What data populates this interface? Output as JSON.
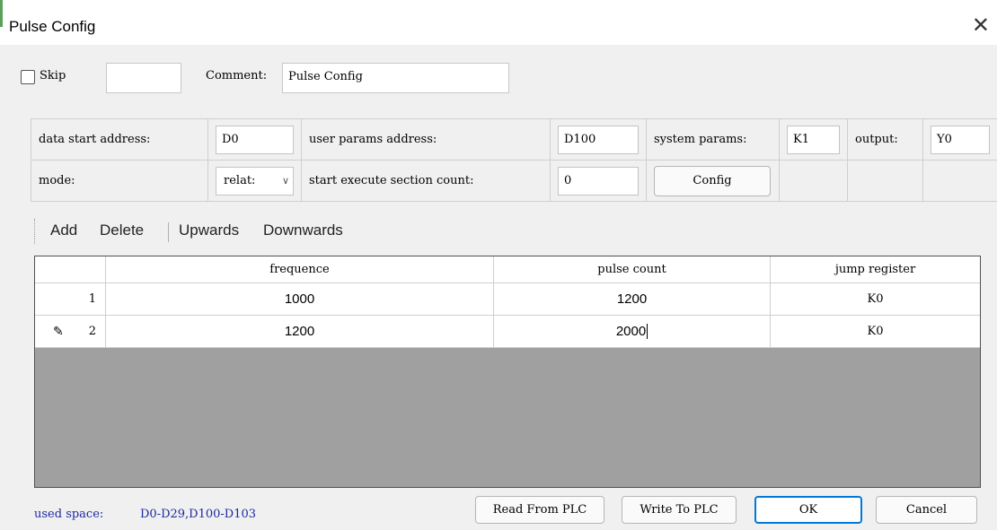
{
  "window": {
    "title": "Pulse Config",
    "close_icon": "close-icon"
  },
  "top": {
    "skip_label": "Skip",
    "skip_checked": false,
    "skip_value": "",
    "comment_label": "Comment:",
    "comment_value": "Pulse Config"
  },
  "config": {
    "data_start_label": "data start address:",
    "data_start_value": "D0",
    "user_params_label": "user params address:",
    "user_params_value": "D100",
    "system_params_label": "system params:",
    "system_params_value": "K1",
    "output_label": "output:",
    "output_value": "Y0",
    "mode_label": "mode:",
    "mode_value": "relat:",
    "section_count_label": "start execute section count:",
    "section_count_value": "0",
    "config_button": "Config"
  },
  "toolbar": {
    "add": "Add",
    "delete": "Delete",
    "upwards": "Upwards",
    "downwards": "Downwards"
  },
  "grid": {
    "columns": [
      "frequence",
      "pulse count",
      "jump register"
    ],
    "rows": [
      {
        "index": "1",
        "frequence": "1000",
        "pulse_count": "1200",
        "jump": "K0"
      },
      {
        "index": "2",
        "frequence": "1200",
        "pulse_count": "2000",
        "jump": "K0"
      }
    ]
  },
  "footer": {
    "used_space_label": "used space:",
    "used_space_value": "D0-D29,D100-D103",
    "read_button": "Read From PLC",
    "write_button": "Write To PLC",
    "ok_button": "OK",
    "cancel_button": "Cancel"
  },
  "colors": {
    "accent_blue": "#0078d7",
    "used_space_text": "#1e28a0",
    "grid_background": "#a0a0a0"
  }
}
